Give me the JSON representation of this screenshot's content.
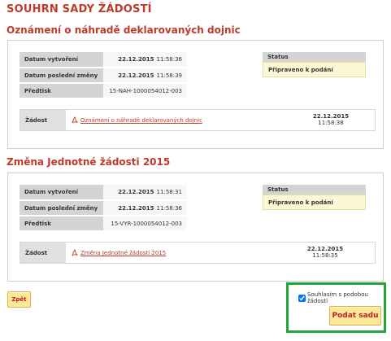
{
  "page_title": "SOUHRN SADY ŽÁDOSTÍ",
  "sections": [
    {
      "title": "Oznámení o náhradě deklarovaných dojnic",
      "meta": [
        {
          "label": "Datum vytvoření",
          "date": "22.12.2015",
          "time": "11:58:36"
        },
        {
          "label": "Datum poslední změny",
          "date": "22.12.2015",
          "time": "11:58:39"
        },
        {
          "label": "Předtisk",
          "value": "15-NAH-1000054012-003"
        }
      ],
      "status_header": "Status",
      "status_value": "Připraveno k podání",
      "zadost_label": "Žádost",
      "zadost_link": "Oznámení o náhradě deklarovaných dojnic",
      "zadost_date": "22.12.2015",
      "zadost_time": "11:58:38"
    },
    {
      "title": "Změna Jednotné žádosti 2015",
      "meta": [
        {
          "label": "Datum vytvoření",
          "date": "22.12.2015",
          "time": "11:58:31"
        },
        {
          "label": "Datum poslední změny",
          "date": "22.12.2015",
          "time": "11:58:36"
        },
        {
          "label": "Předtisk",
          "value": "15-VYR-1000054012-003"
        }
      ],
      "status_header": "Status",
      "status_value": "Připraveno k podání",
      "zadost_label": "Žádost",
      "zadost_link": "Změna Jednotné žádosti 2015",
      "zadost_date": "22.12.2015",
      "zadost_time": "11:58:35"
    }
  ],
  "back_button": "Zpět",
  "agree_label": "Souhlasím s podobou žádosti",
  "agree_checked": true,
  "submit_button": "Podat sadu",
  "colors": {
    "title_red": "#c0392b",
    "button_yellow": "#fde89a",
    "highlight_green": "#23a537",
    "status_yellow": "#fcf8d6"
  },
  "icons": {
    "document": "pdf-icon"
  }
}
